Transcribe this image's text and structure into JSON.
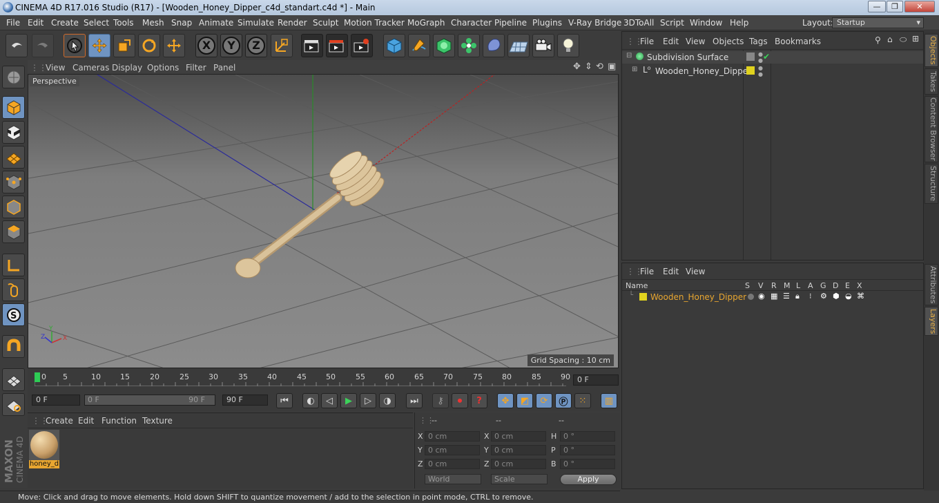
{
  "window": {
    "title": "CINEMA 4D R17.016 Studio (R17) - [Wooden_Honey_Dipper_c4d_standart.c4d *] - Main",
    "minimize": "—",
    "maximize": "❐",
    "close": "✕"
  },
  "menu": [
    "File",
    "Edit",
    "Create",
    "Select",
    "Tools",
    "Mesh",
    "Snap",
    "Animate",
    "Simulate",
    "Render",
    "Sculpt",
    "Motion Tracker",
    "MoGraph",
    "Character",
    "Pipeline",
    "Plugins",
    "V-Ray Bridge",
    "3DToAll",
    "Script",
    "Window",
    "Help"
  ],
  "layout": {
    "label": "Layout:",
    "value": "Startup"
  },
  "toolbar": {
    "x": "X",
    "y": "Y",
    "z": "Z"
  },
  "viewport": {
    "menu": [
      "View",
      "Cameras",
      "Display",
      "Options",
      "Filter",
      "Panel"
    ],
    "camera_label": "Perspective",
    "grid_spacing": "Grid Spacing : 10 cm"
  },
  "timeline": {
    "ticks": [
      "0",
      "5",
      "10",
      "15",
      "20",
      "25",
      "30",
      "35",
      "40",
      "45",
      "50",
      "55",
      "60",
      "65",
      "70",
      "75",
      "80",
      "85",
      "90"
    ],
    "current_frame": "0 F"
  },
  "playback": {
    "start": "0 F",
    "range_start": "0 F",
    "range_end": "90 F",
    "end": "90 F"
  },
  "materials": {
    "menu": [
      "Create",
      "Edit",
      "Function",
      "Texture"
    ],
    "items": [
      {
        "name": "honey_d"
      }
    ]
  },
  "coordinates": {
    "headers": [
      "--",
      "--",
      "--"
    ],
    "rows": [
      {
        "a": "X",
        "av": "0 cm",
        "b": "X",
        "bv": "0 cm",
        "c": "H",
        "cv": "0 °"
      },
      {
        "a": "Y",
        "av": "0 cm",
        "b": "Y",
        "bv": "0 cm",
        "c": "P",
        "cv": "0 °"
      },
      {
        "a": "Z",
        "av": "0 cm",
        "b": "Z",
        "bv": "0 cm",
        "c": "B",
        "cv": "0 °"
      }
    ],
    "mode1": "World",
    "mode2": "Scale",
    "apply": "Apply"
  },
  "status": "Move: Click and drag to move elements. Hold down SHIFT to quantize movement / add to the selection in point mode, CTRL to remove.",
  "objects": {
    "menu": [
      "File",
      "Edit",
      "View",
      "Objects",
      "Tags",
      "Bookmarks"
    ],
    "tree": [
      {
        "name": "Subdivision Surface"
      },
      {
        "name": "Wooden_Honey_Dipper"
      }
    ]
  },
  "layers": {
    "menu": [
      "File",
      "Edit",
      "View"
    ],
    "columns": [
      "Name",
      "S",
      "V",
      "R",
      "M",
      "L",
      "A",
      "G",
      "D",
      "E",
      "X"
    ],
    "rows": [
      {
        "name": "Wooden_Honey_Dipper"
      }
    ]
  },
  "side_tabs": [
    "Objects",
    "Takes",
    "Content Browser",
    "Structure",
    "Attributes",
    "Layers"
  ],
  "colors": {
    "accent": "#6f94c2",
    "layer_yellow": "#e0d21e",
    "layer_text": "#e8a630"
  }
}
